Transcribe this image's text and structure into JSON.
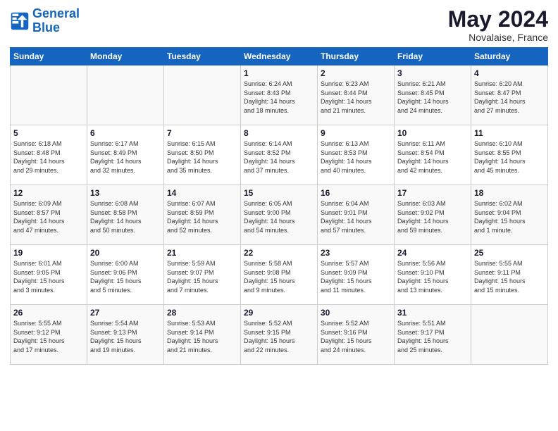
{
  "header": {
    "logo_line1": "General",
    "logo_line2": "Blue",
    "month": "May 2024",
    "location": "Novalaise, France"
  },
  "weekdays": [
    "Sunday",
    "Monday",
    "Tuesday",
    "Wednesday",
    "Thursday",
    "Friday",
    "Saturday"
  ],
  "weeks": [
    [
      {
        "num": "",
        "info": ""
      },
      {
        "num": "",
        "info": ""
      },
      {
        "num": "",
        "info": ""
      },
      {
        "num": "1",
        "info": "Sunrise: 6:24 AM\nSunset: 8:43 PM\nDaylight: 14 hours\nand 18 minutes."
      },
      {
        "num": "2",
        "info": "Sunrise: 6:23 AM\nSunset: 8:44 PM\nDaylight: 14 hours\nand 21 minutes."
      },
      {
        "num": "3",
        "info": "Sunrise: 6:21 AM\nSunset: 8:45 PM\nDaylight: 14 hours\nand 24 minutes."
      },
      {
        "num": "4",
        "info": "Sunrise: 6:20 AM\nSunset: 8:47 PM\nDaylight: 14 hours\nand 27 minutes."
      }
    ],
    [
      {
        "num": "5",
        "info": "Sunrise: 6:18 AM\nSunset: 8:48 PM\nDaylight: 14 hours\nand 29 minutes."
      },
      {
        "num": "6",
        "info": "Sunrise: 6:17 AM\nSunset: 8:49 PM\nDaylight: 14 hours\nand 32 minutes."
      },
      {
        "num": "7",
        "info": "Sunrise: 6:15 AM\nSunset: 8:50 PM\nDaylight: 14 hours\nand 35 minutes."
      },
      {
        "num": "8",
        "info": "Sunrise: 6:14 AM\nSunset: 8:52 PM\nDaylight: 14 hours\nand 37 minutes."
      },
      {
        "num": "9",
        "info": "Sunrise: 6:13 AM\nSunset: 8:53 PM\nDaylight: 14 hours\nand 40 minutes."
      },
      {
        "num": "10",
        "info": "Sunrise: 6:11 AM\nSunset: 8:54 PM\nDaylight: 14 hours\nand 42 minutes."
      },
      {
        "num": "11",
        "info": "Sunrise: 6:10 AM\nSunset: 8:55 PM\nDaylight: 14 hours\nand 45 minutes."
      }
    ],
    [
      {
        "num": "12",
        "info": "Sunrise: 6:09 AM\nSunset: 8:57 PM\nDaylight: 14 hours\nand 47 minutes."
      },
      {
        "num": "13",
        "info": "Sunrise: 6:08 AM\nSunset: 8:58 PM\nDaylight: 14 hours\nand 50 minutes."
      },
      {
        "num": "14",
        "info": "Sunrise: 6:07 AM\nSunset: 8:59 PM\nDaylight: 14 hours\nand 52 minutes."
      },
      {
        "num": "15",
        "info": "Sunrise: 6:05 AM\nSunset: 9:00 PM\nDaylight: 14 hours\nand 54 minutes."
      },
      {
        "num": "16",
        "info": "Sunrise: 6:04 AM\nSunset: 9:01 PM\nDaylight: 14 hours\nand 57 minutes."
      },
      {
        "num": "17",
        "info": "Sunrise: 6:03 AM\nSunset: 9:02 PM\nDaylight: 14 hours\nand 59 minutes."
      },
      {
        "num": "18",
        "info": "Sunrise: 6:02 AM\nSunset: 9:04 PM\nDaylight: 15 hours\nand 1 minute."
      }
    ],
    [
      {
        "num": "19",
        "info": "Sunrise: 6:01 AM\nSunset: 9:05 PM\nDaylight: 15 hours\nand 3 minutes."
      },
      {
        "num": "20",
        "info": "Sunrise: 6:00 AM\nSunset: 9:06 PM\nDaylight: 15 hours\nand 5 minutes."
      },
      {
        "num": "21",
        "info": "Sunrise: 5:59 AM\nSunset: 9:07 PM\nDaylight: 15 hours\nand 7 minutes."
      },
      {
        "num": "22",
        "info": "Sunrise: 5:58 AM\nSunset: 9:08 PM\nDaylight: 15 hours\nand 9 minutes."
      },
      {
        "num": "23",
        "info": "Sunrise: 5:57 AM\nSunset: 9:09 PM\nDaylight: 15 hours\nand 11 minutes."
      },
      {
        "num": "24",
        "info": "Sunrise: 5:56 AM\nSunset: 9:10 PM\nDaylight: 15 hours\nand 13 minutes."
      },
      {
        "num": "25",
        "info": "Sunrise: 5:55 AM\nSunset: 9:11 PM\nDaylight: 15 hours\nand 15 minutes."
      }
    ],
    [
      {
        "num": "26",
        "info": "Sunrise: 5:55 AM\nSunset: 9:12 PM\nDaylight: 15 hours\nand 17 minutes."
      },
      {
        "num": "27",
        "info": "Sunrise: 5:54 AM\nSunset: 9:13 PM\nDaylight: 15 hours\nand 19 minutes."
      },
      {
        "num": "28",
        "info": "Sunrise: 5:53 AM\nSunset: 9:14 PM\nDaylight: 15 hours\nand 21 minutes."
      },
      {
        "num": "29",
        "info": "Sunrise: 5:52 AM\nSunset: 9:15 PM\nDaylight: 15 hours\nand 22 minutes."
      },
      {
        "num": "30",
        "info": "Sunrise: 5:52 AM\nSunset: 9:16 PM\nDaylight: 15 hours\nand 24 minutes."
      },
      {
        "num": "31",
        "info": "Sunrise: 5:51 AM\nSunset: 9:17 PM\nDaylight: 15 hours\nand 25 minutes."
      },
      {
        "num": "",
        "info": ""
      }
    ]
  ]
}
